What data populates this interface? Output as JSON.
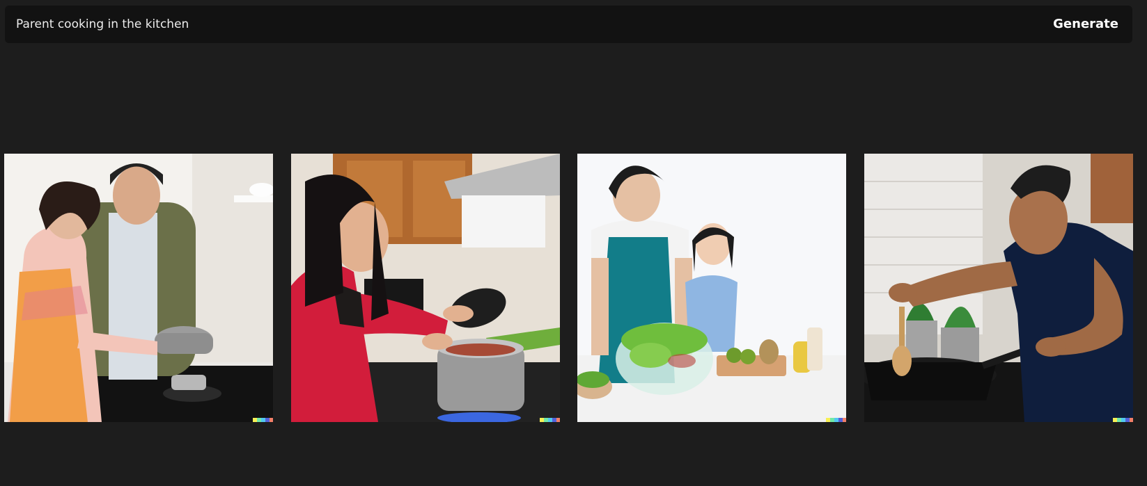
{
  "prompt": {
    "value": "Parent cooking in the kitchen"
  },
  "generate_label": "Generate",
  "images": [
    {
      "subject": "couple-cooking-at-induction-stove"
    },
    {
      "subject": "woman-stirring-pot-on-stove"
    },
    {
      "subject": "parent-and-child-making-salad"
    },
    {
      "subject": "man-stirring-wok"
    }
  ],
  "signature_colors": [
    "#f7f055",
    "#72e8a7",
    "#52c8f0",
    "#5362d9",
    "#f17f6a"
  ]
}
